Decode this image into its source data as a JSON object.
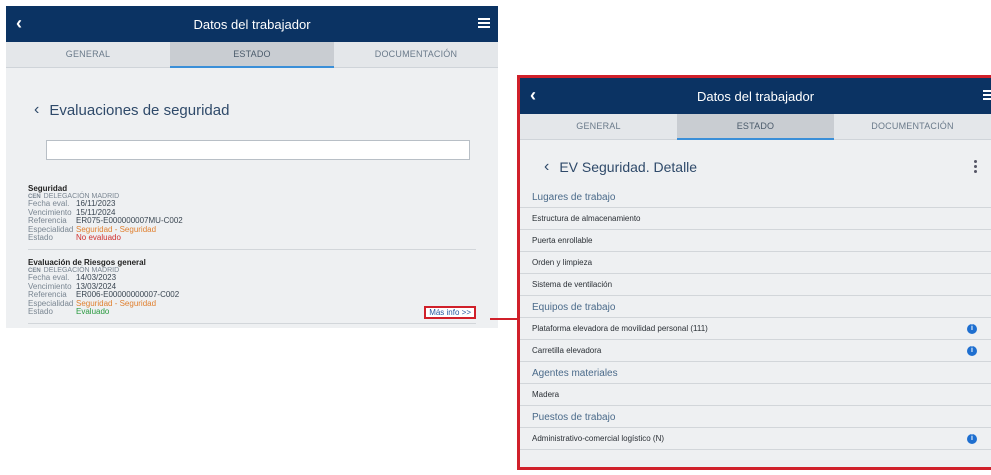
{
  "left": {
    "appbar": {
      "title": "Datos del trabajador",
      "back": "‹"
    },
    "tabs": [
      "GENERAL",
      "ESTADO",
      "DOCUMENTACIÓN"
    ],
    "section_title": "Evaluaciones de seguridad",
    "search": {
      "value": "",
      "placeholder": ""
    },
    "cards": [
      {
        "title": "Seguridad",
        "cen_tag": "CEN",
        "cen": "DELEGACIÓN MADRID",
        "rows": [
          {
            "k": "Fecha eval.",
            "v": "16/11/2023"
          },
          {
            "k": "Vencimiento",
            "v": "15/11/2024"
          },
          {
            "k": "Referencia",
            "v": "ER075-E000000007MU-C002"
          },
          {
            "k": "Especialidad",
            "v": "Seguridad - Seguridad"
          },
          {
            "k": "Estado",
            "v": "No evaluado"
          }
        ]
      },
      {
        "title": "Evaluación de Riesgos general",
        "cen_tag": "CEN",
        "cen": "DELEGACIÓN MADRID",
        "rows": [
          {
            "k": "Fecha eval.",
            "v": "14/03/2023"
          },
          {
            "k": "Vencimiento",
            "v": "13/03/2024"
          },
          {
            "k": "Referencia",
            "v": "ER006-E00000000007-C002"
          },
          {
            "k": "Especialidad",
            "v": "Seguridad - Seguridad"
          },
          {
            "k": "Estado",
            "v": "Evaluado"
          }
        ],
        "more": "Más info >>"
      }
    ]
  },
  "right": {
    "appbar": {
      "title": "Datos del trabajador",
      "back": "‹"
    },
    "tabs": [
      "GENERAL",
      "ESTADO",
      "DOCUMENTACIÓN"
    ],
    "section_title": "EV Seguridad. Detalle",
    "groups": [
      {
        "head": "Lugares de trabajo",
        "items": [
          "Estructura de almacenamiento",
          "Puerta enrollable",
          "Orden y limpieza",
          "Sistema de ventilación"
        ]
      },
      {
        "head": "Equipos de trabajo",
        "items": [
          "Plataforma elevadora de movilidad personal (111)",
          "Carretilla elevadora"
        ]
      },
      {
        "head": "Agentes materiales",
        "items": [
          "Madera"
        ]
      },
      {
        "head": "Puestos de trabajo",
        "items": [
          "Administrativo-comercial logístico (N)"
        ]
      }
    ]
  },
  "colors": {
    "appbar": "#0b3363",
    "accent": "#3a8fd8",
    "highlight": "#d0202a",
    "info": "#1e6fd0"
  }
}
